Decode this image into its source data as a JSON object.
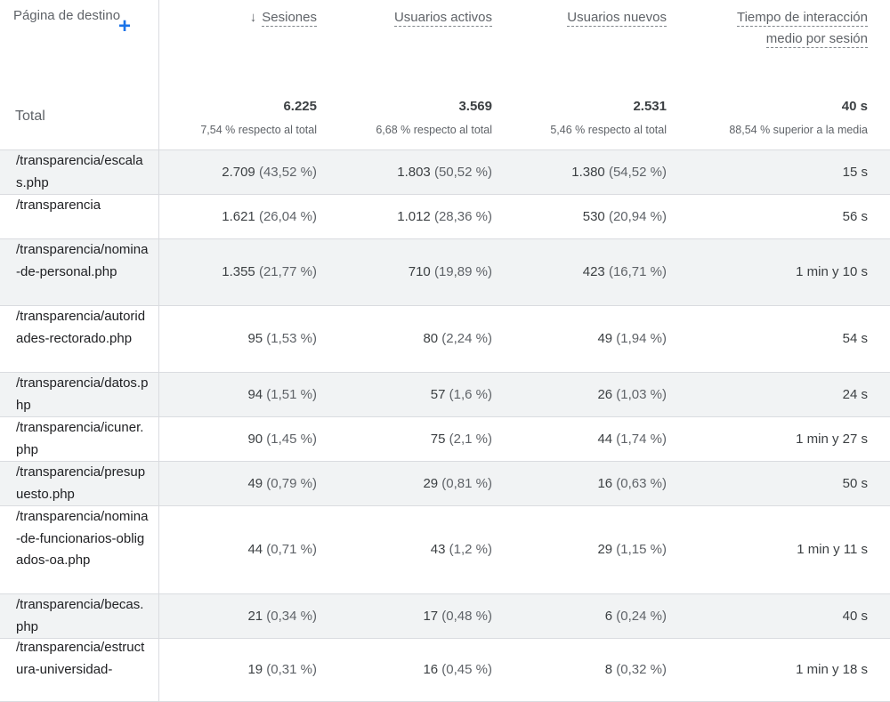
{
  "header": {
    "dimension": "Página de destino",
    "add_label": "+",
    "sort_arrow": "↓",
    "col_sessions": "Sesiones",
    "col_active": "Usuarios activos",
    "col_new": "Usuarios nuevos",
    "col_time_line1": "Tiempo de interacción",
    "col_time_line2": "medio por sesión"
  },
  "totals": {
    "label": "Total",
    "sessions": "6.225",
    "sessions_sub": "7,54 % respecto al total",
    "active": "3.569",
    "active_sub": "6,68 % respecto al total",
    "new": "2.531",
    "new_sub": "5,46 % respecto al total",
    "time": "40 s",
    "time_sub": "88,54 % superior a la media"
  },
  "rows": [
    {
      "page": "/transparencia/escalas.php",
      "sessions": "2.709",
      "sessions_pct": "(43,52 %)",
      "active": "1.803",
      "active_pct": "(50,52 %)",
      "new": "1.380",
      "new_pct": "(54,52 %)",
      "time": "15 s"
    },
    {
      "page": "/transparencia",
      "sessions": "1.621",
      "sessions_pct": "(26,04 %)",
      "active": "1.012",
      "active_pct": "(28,36 %)",
      "new": "530",
      "new_pct": "(20,94 %)",
      "time": "56 s"
    },
    {
      "page": "/transparencia/nomina-de-personal.php",
      "sessions": "1.355",
      "sessions_pct": "(21,77 %)",
      "active": "710",
      "active_pct": "(19,89 %)",
      "new": "423",
      "new_pct": "(16,71 %)",
      "time": "1 min y 10 s"
    },
    {
      "page": "/transparencia/autoridades-rectorado.php",
      "sessions": "95",
      "sessions_pct": "(1,53 %)",
      "active": "80",
      "active_pct": "(2,24 %)",
      "new": "49",
      "new_pct": "(1,94 %)",
      "time": "54 s"
    },
    {
      "page": "/transparencia/datos.php",
      "sessions": "94",
      "sessions_pct": "(1,51 %)",
      "active": "57",
      "active_pct": "(1,6 %)",
      "new": "26",
      "new_pct": "(1,03 %)",
      "time": "24 s"
    },
    {
      "page": "/transparencia/icuner.php",
      "sessions": "90",
      "sessions_pct": "(1,45 %)",
      "active": "75",
      "active_pct": "(2,1 %)",
      "new": "44",
      "new_pct": "(1,74 %)",
      "time": "1 min y 27 s"
    },
    {
      "page": "/transparencia/presupuesto.php",
      "sessions": "49",
      "sessions_pct": "(0,79 %)",
      "active": "29",
      "active_pct": "(0,81 %)",
      "new": "16",
      "new_pct": "(0,63 %)",
      "time": "50 s"
    },
    {
      "page": "/transparencia/nomina-de-funcionarios-obligados-oa.php",
      "sessions": "44",
      "sessions_pct": "(0,71 %)",
      "active": "43",
      "active_pct": "(1,2 %)",
      "new": "29",
      "new_pct": "(1,15 %)",
      "time": "1 min y 11 s"
    },
    {
      "page": "/transparencia/becas.php",
      "sessions": "21",
      "sessions_pct": "(0,34 %)",
      "active": "17",
      "active_pct": "(0,48 %)",
      "new": "6",
      "new_pct": "(0,24 %)",
      "time": "40 s"
    },
    {
      "page": "/transparencia/estructura-universidad-",
      "sessions": "19",
      "sessions_pct": "(0,31 %)",
      "active": "16",
      "active_pct": "(0,45 %)",
      "new": "8",
      "new_pct": "(0,32 %)",
      "time": "1 min y 18 s"
    }
  ],
  "colors": {
    "accent": "#1a73e8",
    "row_shade": "#f1f3f4",
    "border": "#dadce0"
  }
}
